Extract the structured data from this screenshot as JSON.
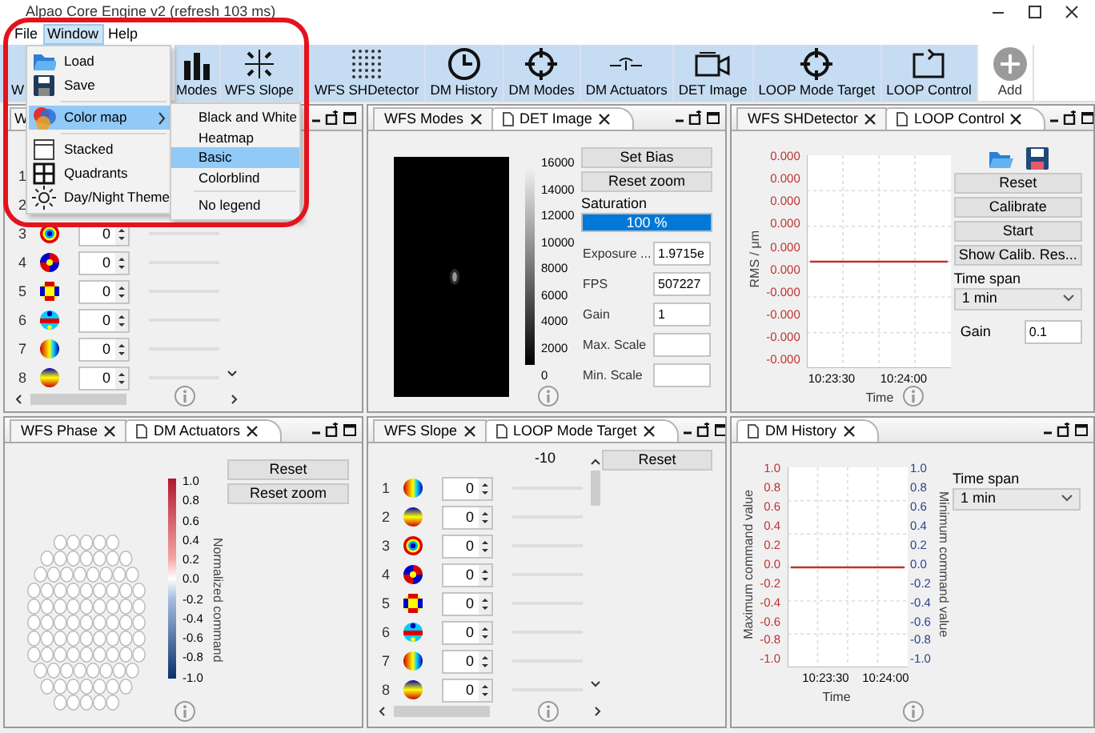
{
  "window": {
    "title": "Alpao Core Engine v2 (refresh 103 ms)"
  },
  "menu_bar": [
    {
      "label": "File",
      "selected": false
    },
    {
      "label": "Window",
      "selected": true
    },
    {
      "label": "Help",
      "selected": false
    }
  ],
  "toolbar": [
    {
      "label": "W",
      "kind": "view"
    },
    {
      "label": "Modes",
      "kind": "view"
    },
    {
      "label": "WFS Slope",
      "kind": "view"
    },
    {
      "label": "WFS SHDetector",
      "kind": "view"
    },
    {
      "label": "DM History",
      "kind": "view"
    },
    {
      "label": "DM Modes",
      "kind": "view"
    },
    {
      "label": "DM Actuators",
      "kind": "view"
    },
    {
      "label": "DET Image",
      "kind": "view"
    },
    {
      "label": "LOOP Mode Target",
      "kind": "view"
    },
    {
      "label": "LOOP Control",
      "kind": "view"
    },
    {
      "label": "Add",
      "kind": "add"
    }
  ],
  "window_menu": [
    {
      "kind": "item",
      "label": "Load",
      "selected": false
    },
    {
      "kind": "item",
      "label": "Save",
      "selected": false
    },
    {
      "kind": "separator"
    },
    {
      "kind": "submenu",
      "label": "Color map",
      "selected": true
    },
    {
      "kind": "separator"
    },
    {
      "kind": "item",
      "label": "Stacked",
      "selected": false
    },
    {
      "kind": "item",
      "label": "Quadrants",
      "selected": false
    },
    {
      "kind": "item",
      "label": "Day/Night Theme",
      "selected": false
    }
  ],
  "color_map_submenu": [
    {
      "kind": "item",
      "label": "Black and White",
      "selected": false
    },
    {
      "kind": "item",
      "label": "Heatmap",
      "selected": false
    },
    {
      "kind": "item",
      "label": "Basic",
      "selected": true
    },
    {
      "kind": "item",
      "label": "Colorblind",
      "selected": false
    },
    {
      "kind": "separator"
    },
    {
      "kind": "item",
      "label": "No legend",
      "selected": false
    }
  ],
  "panels": [
    {
      "kind": "modes",
      "tabs": [
        {
          "label": "W",
          "selected": false
        }
      ],
      "rows": [
        {
          "number": "1"
        },
        {
          "number": "2"
        },
        {
          "number": "3",
          "value": "0"
        },
        {
          "number": "4",
          "value": "0"
        },
        {
          "number": "5",
          "value": "0"
        },
        {
          "number": "6",
          "value": "0"
        },
        {
          "number": "7",
          "value": "0"
        },
        {
          "number": "8",
          "value": "0"
        }
      ]
    },
    {
      "kind": "det",
      "tabs": [
        {
          "label": "WFS Modes",
          "selected": false
        },
        {
          "label": "DET Image",
          "selected": true
        }
      ],
      "colorbar_ticks": [
        "16000",
        "14000",
        "12000",
        "10000",
        "8000",
        "6000",
        "4000",
        "2000",
        "0"
      ],
      "buttons": [
        "Set Bias",
        "Reset zoom"
      ],
      "saturation": {
        "label": "Saturation",
        "level": 1,
        "reading": "100 %"
      },
      "fields": [
        {
          "label": "Exposure ...",
          "value": "1.9715e"
        },
        {
          "label": "FPS",
          "value": "507227"
        },
        {
          "label": "Gain",
          "value": "1"
        },
        {
          "label": "Max. Scale"
        },
        {
          "label": "Min. Scale"
        }
      ]
    },
    {
      "kind": "loop_control",
      "tabs": [
        {
          "label": "WFS SHDetector",
          "selected": false
        },
        {
          "label": "LOOP Control",
          "selected": true
        }
      ],
      "y_ticks": [
        "0.000",
        "0.000",
        "0.000",
        "0.000",
        "0.000",
        "0.000",
        "-0.000",
        "-0.000",
        "-0.000",
        "-0.000"
      ],
      "y_label": "RMS / μm",
      "x_ticks": [
        "10:23:30",
        "10:24:00"
      ],
      "x_label": "Time",
      "buttons": [
        "Reset",
        "Calibrate",
        "Start",
        "Show Calib. Res..."
      ],
      "time_span": {
        "label": "Time span",
        "value": "1 min"
      },
      "gain": {
        "label": "Gain",
        "value": "0.1"
      }
    },
    {
      "kind": "actuators",
      "tabs": [
        {
          "label": "WFS Phase",
          "selected": false
        },
        {
          "label": "DM Actuators",
          "selected": true
        }
      ],
      "colorbar_ticks": [
        "1.0",
        "0.8",
        "0.6",
        "0.4",
        "0.2",
        "0.0",
        "-0.2",
        "-0.4",
        "-0.6",
        "-0.8",
        "-1.0"
      ],
      "colorbar_label": "Normalized command",
      "buttons": [
        "Reset",
        "Reset zoom"
      ]
    },
    {
      "kind": "modes",
      "tabs": [
        {
          "label": "WFS Slope",
          "selected": false
        },
        {
          "label": "LOOP Mode Target",
          "selected": true
        }
      ],
      "header": "-10",
      "buttons": [
        "Reset"
      ],
      "rows": [
        {
          "number": "1",
          "value": "0"
        },
        {
          "number": "2",
          "value": "0"
        },
        {
          "number": "3",
          "value": "0"
        },
        {
          "number": "4",
          "value": "0"
        },
        {
          "number": "5",
          "value": "0"
        },
        {
          "number": "6",
          "value": "0"
        },
        {
          "number": "7",
          "value": "0"
        },
        {
          "number": "8",
          "value": "0"
        }
      ]
    },
    {
      "kind": "history",
      "tabs": [
        {
          "label": "DM History",
          "selected": true
        }
      ],
      "left_ticks": [
        "1.0",
        "0.8",
        "0.6",
        "0.4",
        "0.2",
        "0.0",
        "-0.2",
        "-0.4",
        "-0.6",
        "-0.8",
        "-1.0"
      ],
      "right_ticks": [
        "1.0",
        "0.8",
        "0.6",
        "0.4",
        "0.2",
        "0.0",
        "-0.2",
        "-0.4",
        "-0.6",
        "-0.8",
        "-1.0"
      ],
      "left_label": "Maximum command value",
      "right_label": "Minimum command value",
      "x_ticks": [
        "10:23:30",
        "10:24:00"
      ],
      "x_label": "Time",
      "time_span": {
        "label": "Time span",
        "value": "1 min"
      }
    }
  ]
}
